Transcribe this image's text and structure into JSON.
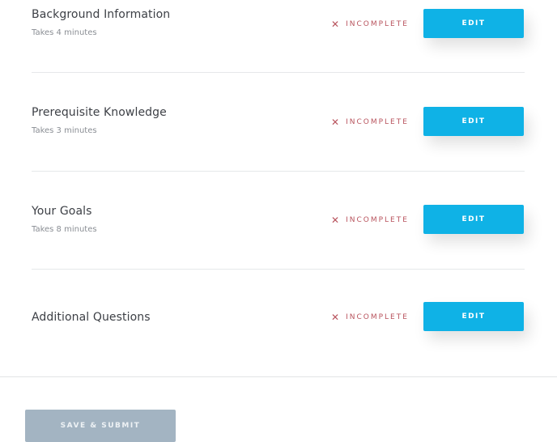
{
  "sections": [
    {
      "title": "Background Information",
      "subtitle": "Takes 4 minutes",
      "status": "INCOMPLETE",
      "status_icon": "close-x-icon",
      "edit_label": "EDIT"
    },
    {
      "title": "Prerequisite Knowledge",
      "subtitle": "Takes 3 minutes",
      "status": "INCOMPLETE",
      "status_icon": "close-x-icon",
      "edit_label": "EDIT"
    },
    {
      "title": "Your Goals",
      "subtitle": "Takes 8 minutes",
      "status": "INCOMPLETE",
      "status_icon": "close-x-icon",
      "edit_label": "EDIT"
    },
    {
      "title": "Additional Questions",
      "subtitle": "",
      "status": "INCOMPLETE",
      "status_icon": "close-x-icon",
      "edit_label": "EDIT"
    }
  ],
  "icons": {
    "incomplete": "✕"
  },
  "colors": {
    "accent": "#0fb2e6",
    "incomplete": "#b8535d",
    "disabled_button": "#a3b4c2"
  },
  "footer": {
    "save_submit_label": "SAVE & SUBMIT"
  }
}
